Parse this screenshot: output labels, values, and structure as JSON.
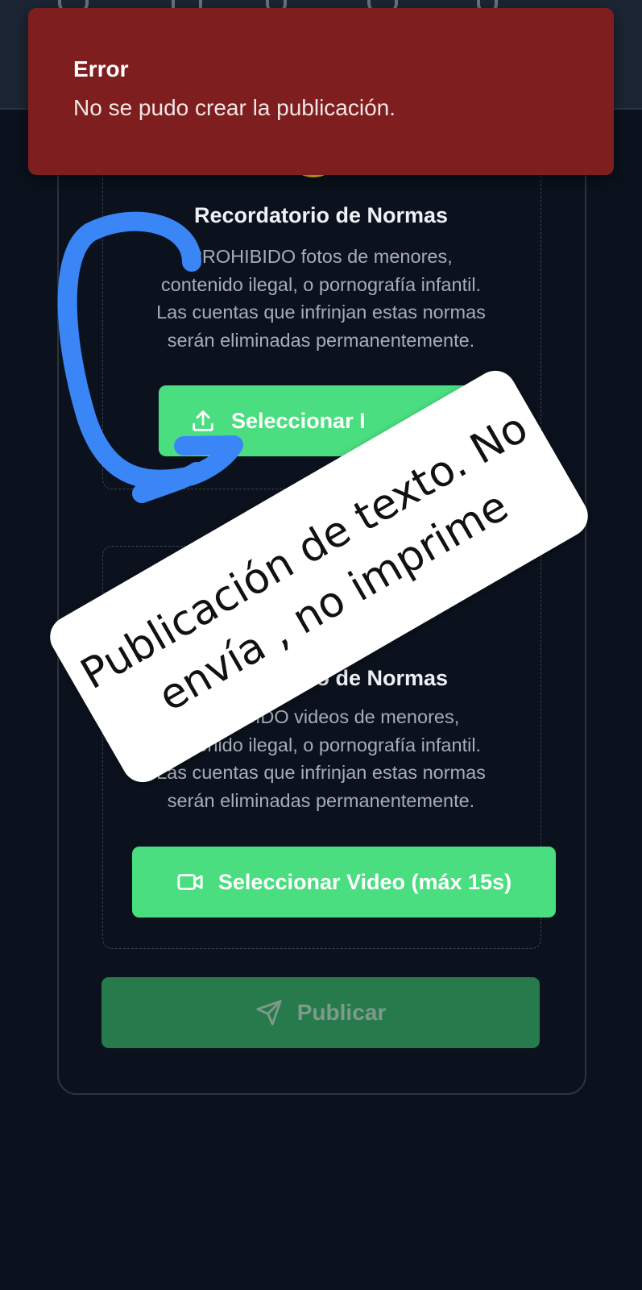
{
  "toast": {
    "title": "Error",
    "message": "No se pudo crear la publicación.",
    "background_color": "#7f1e1e"
  },
  "image_section": {
    "warning_icon": "warning-triangle-icon",
    "rules_title": "Recordatorio de Normas",
    "rules_lines": [
      "PROHIBIDO fotos de menores,",
      "contenido ilegal, o pornografía infantil.",
      "Las cuentas que infrinjan estas normas",
      "serán eliminadas permanentemente."
    ],
    "button_icon": "upload-icon",
    "button_label": "Seleccionar I"
  },
  "video_section": {
    "warning_icon": "warning-triangle-icon",
    "rules_title": "Recordatorio de Normas",
    "rules_lines": [
      "PROHIBIDO videos de menores,",
      "contenido ilegal, o pornografía infantil.",
      "Las cuentas que infrinjan estas normas",
      "serán eliminadas permanentemente."
    ],
    "button_icon": "video-camera-icon",
    "button_label": "Seleccionar Video (máx 15s)"
  },
  "publish": {
    "icon": "send-icon",
    "label": "Publicar",
    "state": "disabled"
  },
  "annotation": {
    "sticker_lines": [
      "Publicación de texto. No",
      "envía , no imprime"
    ],
    "arrow_color": "#3b82f6"
  },
  "colors": {
    "background": "#0b121d",
    "accent_green": "#4ade80",
    "publish_green": "#277a4c",
    "warning_yellow": "#facc15"
  }
}
